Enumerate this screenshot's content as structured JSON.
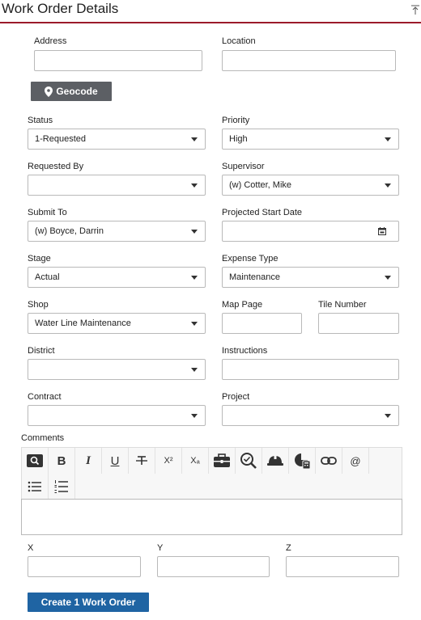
{
  "header": {
    "title": "Work Order Details",
    "collapse_icon": "collapse-to-top-icon"
  },
  "form": {
    "address": {
      "label": "Address",
      "value": ""
    },
    "location": {
      "label": "Location",
      "value": ""
    },
    "geocode_button": "Geocode",
    "status": {
      "label": "Status",
      "value": "1-Requested"
    },
    "priority": {
      "label": "Priority",
      "value": "High"
    },
    "requested_by": {
      "label": "Requested By",
      "value": ""
    },
    "supervisor": {
      "label": "Supervisor",
      "value": "(w) Cotter, Mike"
    },
    "submit_to": {
      "label": "Submit To",
      "value": "(w) Boyce, Darrin"
    },
    "projected_start_date": {
      "label": "Projected Start Date",
      "value": ""
    },
    "stage": {
      "label": "Stage",
      "value": "Actual"
    },
    "expense_type": {
      "label": "Expense Type",
      "value": "Maintenance"
    },
    "shop": {
      "label": "Shop",
      "value": "Water Line Maintenance"
    },
    "map_page": {
      "label": "Map Page",
      "value": ""
    },
    "tile_number": {
      "label": "Tile Number",
      "value": ""
    },
    "district": {
      "label": "District",
      "value": ""
    },
    "instructions": {
      "label": "Instructions",
      "value": ""
    },
    "contract": {
      "label": "Contract",
      "value": ""
    },
    "project": {
      "label": "Project",
      "value": ""
    },
    "comments": {
      "label": "Comments",
      "value": ""
    },
    "x": {
      "label": "X",
      "value": ""
    },
    "y": {
      "label": "Y",
      "value": ""
    },
    "z": {
      "label": "Z",
      "value": ""
    }
  },
  "toolbar": {
    "bold": "B",
    "italic": "I",
    "underline": "U",
    "superscript": "X²",
    "subscript": "Xₐ",
    "mention": "@"
  },
  "actions": {
    "create_label": "Create 1 Work Order"
  },
  "colors": {
    "header_rule": "#9b1b2a",
    "primary_button": "#1f64a3",
    "geocode_button": "#5c5f64"
  }
}
